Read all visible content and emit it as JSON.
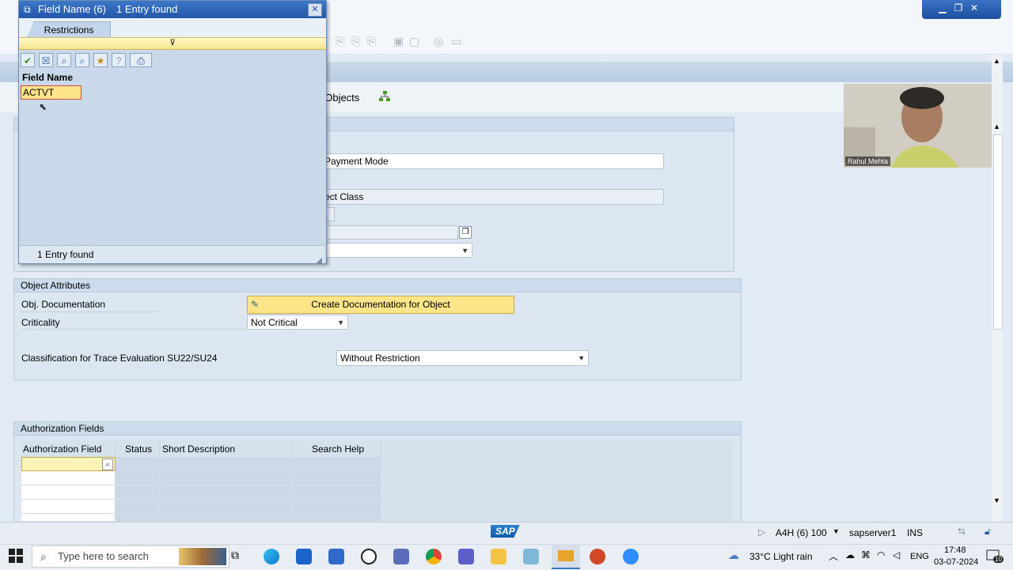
{
  "popup": {
    "title": "Field Name (6)",
    "entries_found_title": "1 Entry found",
    "tab_label": "Restrictions",
    "column_header": "Field Name",
    "result_value": "ACTVT",
    "status_text": "1 Entry found"
  },
  "main": {
    "toolbar_link": "t Objects",
    "field_payment_mode": "Payment Mode",
    "field_object_class": "ect Class",
    "object_attributes": {
      "header": "Object Attributes",
      "obj_doc_label": "Obj. Documentation",
      "create_doc_button": "Create Documentation for Object",
      "criticality_label": "Criticality",
      "criticality_value": "Not Critical",
      "trace_label": "Classification for Trace Evaluation SU22/SU24",
      "trace_value": "Without Restriction"
    },
    "authorization_fields": {
      "header": "Authorization Fields",
      "columns": [
        "Authorization Field",
        "Status",
        "Short Description",
        "Search Help"
      ]
    }
  },
  "webcam": {
    "name": "Rahul Mehta"
  },
  "statusbar": {
    "system": "A4H (6) 100",
    "server": "sapserver1",
    "mode": "INS",
    "logo": "SAP"
  },
  "taskbar": {
    "search_placeholder": "Type here to search",
    "weather": "33°C  Light rain",
    "language": "ENG",
    "time": "17:48",
    "date": "03-07-2024",
    "notification_count": "10"
  },
  "colors": {
    "title_blue": "#2356a6",
    "highlight_yellow": "#fbe588",
    "panel_blue": "#dbe6f1"
  }
}
